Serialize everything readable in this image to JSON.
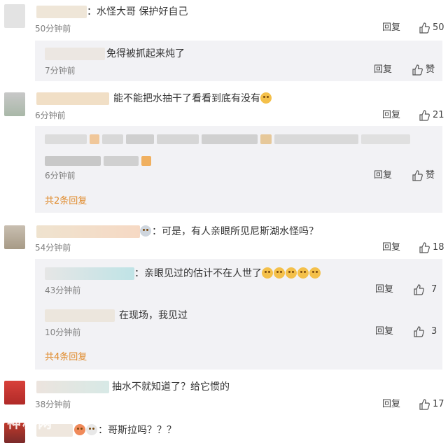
{
  "comments": [
    {
      "text": "：水怪大哥  保护好自己",
      "time": "50分钟前",
      "reply": "回复",
      "likes": "50"
    },
    {
      "text": "能不能把水抽干了看看到底有没有",
      "time": "6分钟前",
      "reply": "回复",
      "likes": "21"
    },
    {
      "text": "：可是，有人亲眼所见尼斯湖水怪吗？",
      "time": "54分钟前",
      "reply": "回复",
      "likes": "18"
    },
    {
      "text": "抽水不就知道了？给它惯的",
      "time": "38分钟前",
      "reply": "回复",
      "likes": "17"
    },
    {
      "text": "：哥斯拉吗？？？",
      "time": "",
      "reply": "",
      "likes": ""
    }
  ],
  "subs": [
    {
      "text": "免得被抓起来炖了",
      "time": "7分钟前",
      "reply": "回复",
      "likes": "赞"
    },
    {
      "text": "",
      "time": "6分钟前",
      "reply": "回复",
      "likes": "赞"
    },
    {
      "text": "：亲眼见过的估计不在人世了",
      "time": "43分钟前",
      "reply": "回复",
      "likes": "7"
    },
    {
      "text": "在现场，我见过",
      "time": "10分钟前",
      "reply": "回复",
      "likes": "3"
    }
  ],
  "more": [
    "共2条回复",
    "共4条回复"
  ],
  "watermark": "神秘网",
  "colors": {
    "more": "#e08b2c",
    "subbox": "#f2f2f5",
    "time": "#808080"
  }
}
